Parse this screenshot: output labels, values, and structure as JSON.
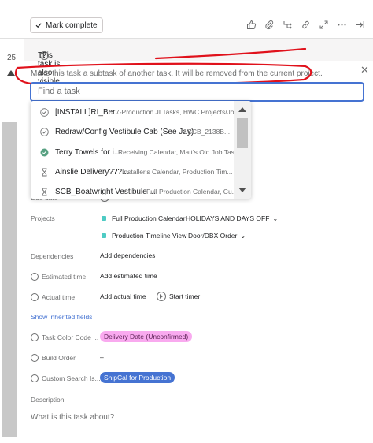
{
  "left_panel": {
    "number": "25"
  },
  "toolbar": {
    "mark_complete_label": "Mark complete",
    "icons": [
      "thumbs-up-icon",
      "attachment-icon",
      "subtask-icon",
      "link-icon",
      "expand-icon",
      "more-icon",
      "close-panel-icon"
    ]
  },
  "banner_readonly": {
    "text": "This task is also visible in a project with a read-only link."
  },
  "banner_subtask": {
    "text": "Make this task a subtask of another task. It will be removed from the current project."
  },
  "search": {
    "placeholder": "Find a task",
    "value": ""
  },
  "dropdown": {
    "items": [
      {
        "icon": "check-circle-icon",
        "name": "[INSTALL]RI_Ber...",
        "project": "7-Production JI Tasks, HWC Projects/Jo..."
      },
      {
        "icon": "check-circle-icon",
        "name": "Redraw/Config Vestibule Cab (See Jay)",
        "project": "‹ SCB_2138B..."
      },
      {
        "icon": "check-circle-filled-icon",
        "name": "Terry Towels for i...",
        "project": "Receiving Calendar, Matt's Old Job Tas..."
      },
      {
        "icon": "hourglass-icon",
        "name": "Ainslie Delivery???...",
        "project": "Installer's Calendar, Production Tim..."
      },
      {
        "icon": "hourglass-icon",
        "name": "SCB_Boatwright Vestibule ...",
        "project": "Full Production Calendar, Cu..."
      }
    ]
  },
  "fields": {
    "due_date_label": "Due date",
    "projects_label": "Projects",
    "projects": [
      {
        "name": "Full Production Calendar",
        "section": "HOLIDAYS AND DAYS OFF"
      },
      {
        "name": "Production Timeline View",
        "section": "Door/DBX Order"
      }
    ],
    "dependencies_label": "Dependencies",
    "dependencies_value": "Add dependencies",
    "estimated_label": "Estimated time",
    "estimated_value": "Add estimated time",
    "actual_label": "Actual time",
    "actual_value": "Add actual time",
    "start_timer": "Start timer",
    "show_inherited": "Show inherited fields",
    "task_color_label": "Task Color Code ...",
    "task_color_value": "Delivery Date (Unconfirmed)",
    "build_order_label": "Build Order",
    "build_order_value": "–",
    "custom_search_label": "Custom Search Is...",
    "custom_search_value": "ShipCal for Production",
    "description_label": "Description",
    "description_placeholder": "What is this task about?"
  },
  "colors": {
    "accent": "#4573d2",
    "annotation": "#e0111b",
    "pink_pill": "#f9aaef",
    "project_square": "#4ecbc4"
  }
}
